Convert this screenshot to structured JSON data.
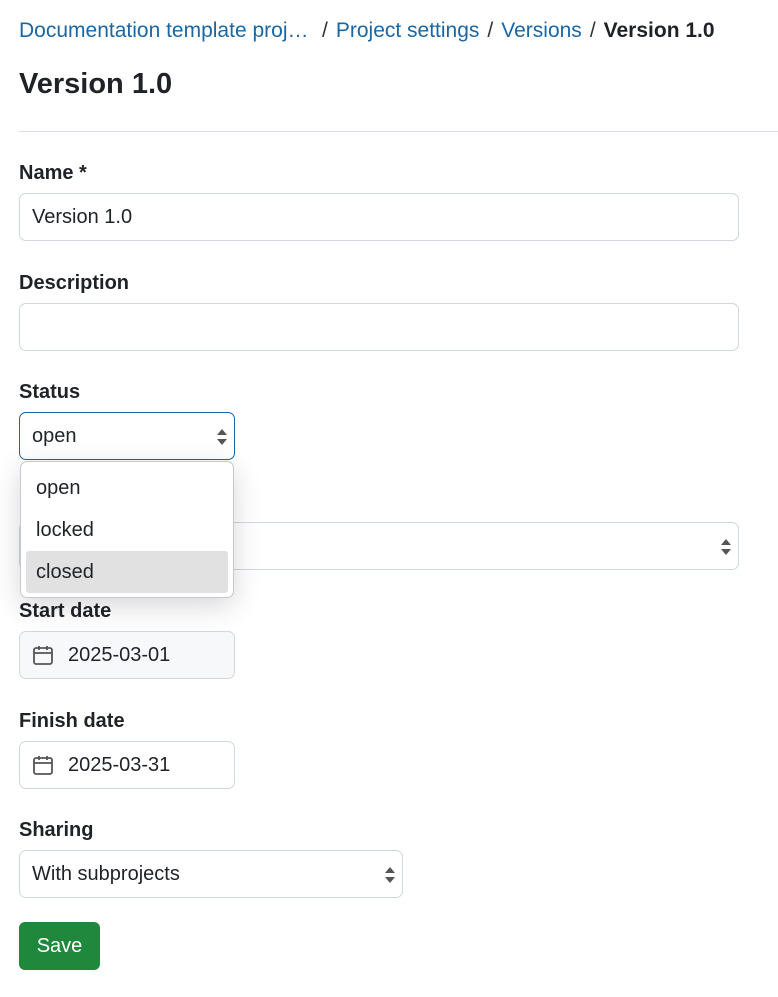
{
  "breadcrumb": {
    "project": "Documentation template project",
    "settings": "Project settings",
    "versions": "Versions",
    "separator": "/",
    "current": "Version 1.0"
  },
  "page_title": "Version 1.0",
  "form": {
    "name": {
      "label": "Name *",
      "value": "Version 1.0"
    },
    "description": {
      "label": "Description",
      "value": "",
      "placeholder": ""
    },
    "status": {
      "label": "Status",
      "value": "open",
      "options": [
        "open",
        "locked",
        "closed"
      ],
      "highlighted_option": "closed"
    },
    "wiki_page": {
      "value": ""
    },
    "start_date": {
      "label": "Start date",
      "value": "2025-03-01"
    },
    "finish_date": {
      "label": "Finish date",
      "value": "2025-03-31"
    },
    "sharing": {
      "label": "Sharing",
      "value": "With subprojects"
    },
    "save_label": "Save"
  },
  "icons": {
    "calendar": "calendar-icon",
    "select_caret": "select-caret-icon"
  },
  "colors": {
    "link": "#1a67a3",
    "save_button": "#1f883d",
    "focus_border": "#1a67a3",
    "option_highlight": "#e1e1e1"
  }
}
